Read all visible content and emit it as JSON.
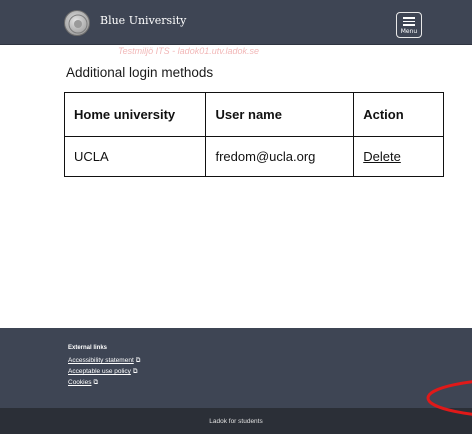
{
  "header": {
    "brand": "Blue University",
    "menu_label": "Menu",
    "logo_icon": "university-seal-icon"
  },
  "watermark": "Testmiljö ITS - ladok01.utv.ladok.se",
  "section": {
    "title": "Additional login methods"
  },
  "table": {
    "columns": [
      "Home university",
      "User name",
      "Action"
    ],
    "rows": [
      {
        "home_university": "UCLA",
        "user_name": "fredom@ucla.org",
        "action": "Delete"
      }
    ]
  },
  "footer": {
    "heading": "External links",
    "links": [
      "Accessibility statement",
      "Acceptable use policy",
      "Cookies"
    ],
    "link_icon": "external-link-icon",
    "bottom_text": "Ladok for students"
  },
  "colors": {
    "header_bg": "#3e4554",
    "bottom_bar_bg": "#2b2f37",
    "watermark": "#f2b8b8",
    "annotation": "#e01919"
  }
}
